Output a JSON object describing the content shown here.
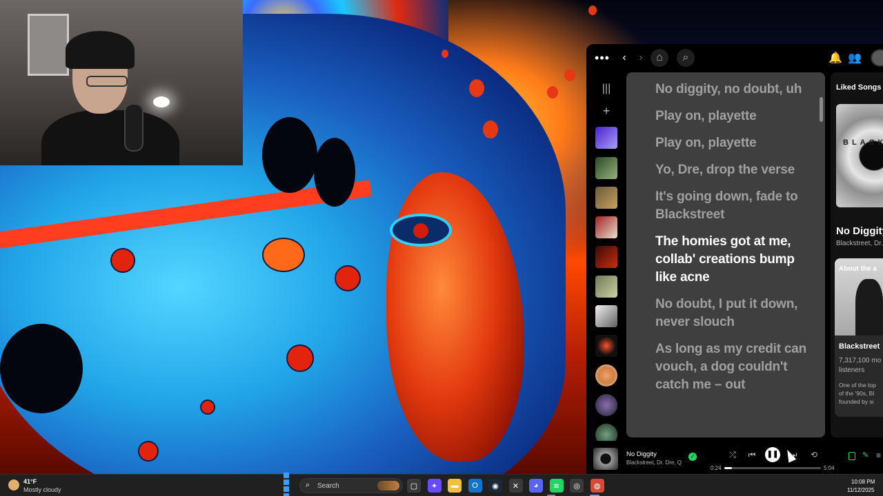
{
  "spotify": {
    "topbar": {
      "more_glyph": "•••",
      "back_glyph": "‹",
      "forward_glyph": "›",
      "home_glyph": "⌂",
      "search_glyph": "⌕",
      "bell_glyph": "🔔",
      "friends_glyph": "👥"
    },
    "library": {
      "collapse_glyph": "|||",
      "add_glyph": "+"
    },
    "lyrics": [
      {
        "text": "No diggity, no doubt, uh",
        "state": "past"
      },
      {
        "text": "Play on, playette",
        "state": "past"
      },
      {
        "text": "Play on, playette",
        "state": "past"
      },
      {
        "text": "Yo, Dre, drop the verse",
        "state": "past"
      },
      {
        "text": "It's going down, fade to Blackstreet",
        "state": "past"
      },
      {
        "text": "The homies got at me, collab' creations bump like acne",
        "state": "active"
      },
      {
        "text": "No doubt, I put it down, never slouch",
        "state": "upcoming"
      },
      {
        "text": "As long as my credit can vouch, a dog couldn't catch me – out",
        "state": "upcoming"
      }
    ],
    "right_panel": {
      "section_title": "Liked Songs",
      "cover_text": "BLACK",
      "song_title": "No Diggity",
      "song_artists": "Blackstreet, Dr. Dre",
      "about_label": "About the a",
      "artist_name": "Blackstreet",
      "listeners_count": "7,317,100 mo",
      "listeners_label": "listeners",
      "bio_line1": "One of the top",
      "bio_line2": "of the '90s, Bl",
      "bio_line3": "founded by si"
    },
    "player": {
      "title": "No Diggity",
      "artists": "Blackstreet, Dr. Dre, Q",
      "saved_glyph": "✓",
      "shuffle_glyph": "⤮",
      "prev_glyph": "⏮",
      "pause_glyph": "❚❚",
      "next_glyph": "⏭",
      "repeat_glyph": "⟲",
      "elapsed": "0:24",
      "total": "5:04",
      "progress_fraction": 0.079,
      "queue_glyph": "≡",
      "mic_glyph": "✎"
    }
  },
  "taskbar": {
    "weather_temp": "41°F",
    "weather_desc": "Mostly cloudy",
    "search_glyph": "⌕",
    "search_label": "Search",
    "clock_time": "10:08 PM",
    "clock_date": "11/12/2025",
    "apps": [
      {
        "name": "task-view-icon",
        "glyph": "▢",
        "color": "#3a3a3a"
      },
      {
        "name": "copilot-icon",
        "glyph": "✦",
        "color": "#6a4aff"
      },
      {
        "name": "file-explorer-icon",
        "glyph": "▬",
        "color": "#f0c040"
      },
      {
        "name": "outlook-icon",
        "glyph": "O",
        "color": "#1473c8"
      },
      {
        "name": "steam-icon",
        "glyph": "◉",
        "color": "#1b2838"
      },
      {
        "name": "xbox-icon",
        "glyph": "✕",
        "color": "#3a3a3a"
      },
      {
        "name": "discord-icon",
        "glyph": "◕",
        "color": "#5865f2"
      },
      {
        "name": "spotify-icon",
        "glyph": "≋",
        "color": "#1ed760"
      },
      {
        "name": "github-icon",
        "glyph": "◎",
        "color": "#3a3a3a"
      },
      {
        "name": "chrome-icon",
        "glyph": "◍",
        "color": "#d84a38"
      }
    ]
  },
  "colors": {
    "spotify_green": "#1ed760",
    "lyrics_bg": "#3f3f3f",
    "lyric_active": "#ffffff",
    "lyric_inactive": "#a0a0a0"
  }
}
